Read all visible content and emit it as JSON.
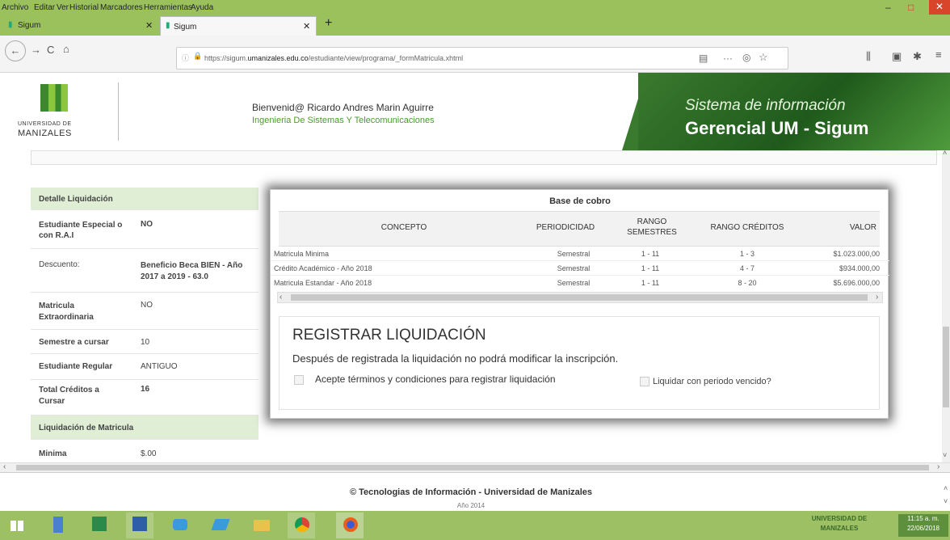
{
  "menu": [
    "Archivo",
    "Editar",
    "Ver",
    "Historial",
    "Marcadores",
    "Herramientas",
    "Ayuda"
  ],
  "tabs": [
    {
      "label": "Sigum"
    },
    {
      "label": "Sigum"
    }
  ],
  "window": {
    "min": "–",
    "max": "□",
    "close": "✕",
    "new_tab": "+",
    "tab_close": "✕"
  },
  "nav": {
    "back": "←",
    "forward": "→",
    "reload": "C",
    "home": "⌂",
    "reader": "▤",
    "more": "···",
    "pocket": "◎",
    "star": "☆",
    "library": "⫼",
    "sidebar": "▣",
    "extension": "✱",
    "menu": "≡",
    "url_prefix": "https://sigum.",
    "url_domain": "umanizales.edu.co",
    "url_path": "/estudiante/view/programa/_formMatricula.xhtml"
  },
  "header": {
    "logo_top": "UNIVERSIDAD DE",
    "logo_bottom": "MANIZALES",
    "welcome": "Bienvenid@ Ricardo Andres Marin Aguirre",
    "program": "Ingenieria De Sistemas Y Telecomunicaciones",
    "brand_line1": "Sistema de información",
    "brand_line2": "Gerencial UM - Sigum"
  },
  "detail": [
    {
      "k": "Detalle Liquidación",
      "v": "",
      "section": true
    },
    {
      "k": "Estudiante Especial o con R.A.I",
      "v": "NO"
    },
    {
      "k": "Descuento:",
      "v": "Beneficio Beca BIEN - Año 2017 a 2019 - 63.0"
    },
    {
      "k": "Matricula Extraordinaria",
      "v": "NO"
    },
    {
      "k": "Semestre a cursar",
      "v": "10"
    },
    {
      "k": "Estudiante Regular",
      "v": "ANTIGUO"
    },
    {
      "k": "Total Créditos a Cursar",
      "v": "16"
    },
    {
      "k": "Liquidación de Matricula",
      "v": "",
      "section": true
    },
    {
      "k": "Minima",
      "v": "$.00"
    }
  ],
  "modal": {
    "title": "Base de cobro",
    "headers": [
      "CONCEPTO",
      "PERIODICIDAD",
      "RANGO SEMESTRES",
      "RANGO CRÉDITOS",
      "VALOR"
    ],
    "rows": [
      [
        "Matricula Minima",
        "Semestral",
        "1 - 11",
        "1 - 3",
        "$1.023.000,00"
      ],
      [
        "Crédito Académico - Año 2018",
        "Semestral",
        "1 - 11",
        "4 - 7",
        "$934.000,00"
      ],
      [
        "Matricula Estandar - Año 2018",
        "Semestral",
        "1 - 11",
        "8 - 20",
        "$5.696.000,00"
      ]
    ],
    "scroll_left": "‹",
    "scroll_right": "›",
    "reg_title": "REGISTRAR LIQUIDACIÓN",
    "reg_note": "Después de registrada la liquidación no podrá modificar la inscripción.",
    "accept_label": "Acepte términos y condiciones para registrar liquidación",
    "expired_label": "Liquidar con periodo vencido?"
  },
  "footer": {
    "line1": "© Tecnologias de Información - Universidad de Manizales",
    "line2": "Año 2014"
  },
  "taskbar": {
    "tray_logo": "UNIVERSIDAD DE MANIZALES",
    "time": "11:15 a. m.",
    "date": "22/06/2018"
  },
  "scroll": {
    "up": "˄",
    "down": "˅",
    "left": "‹",
    "right": "›"
  }
}
